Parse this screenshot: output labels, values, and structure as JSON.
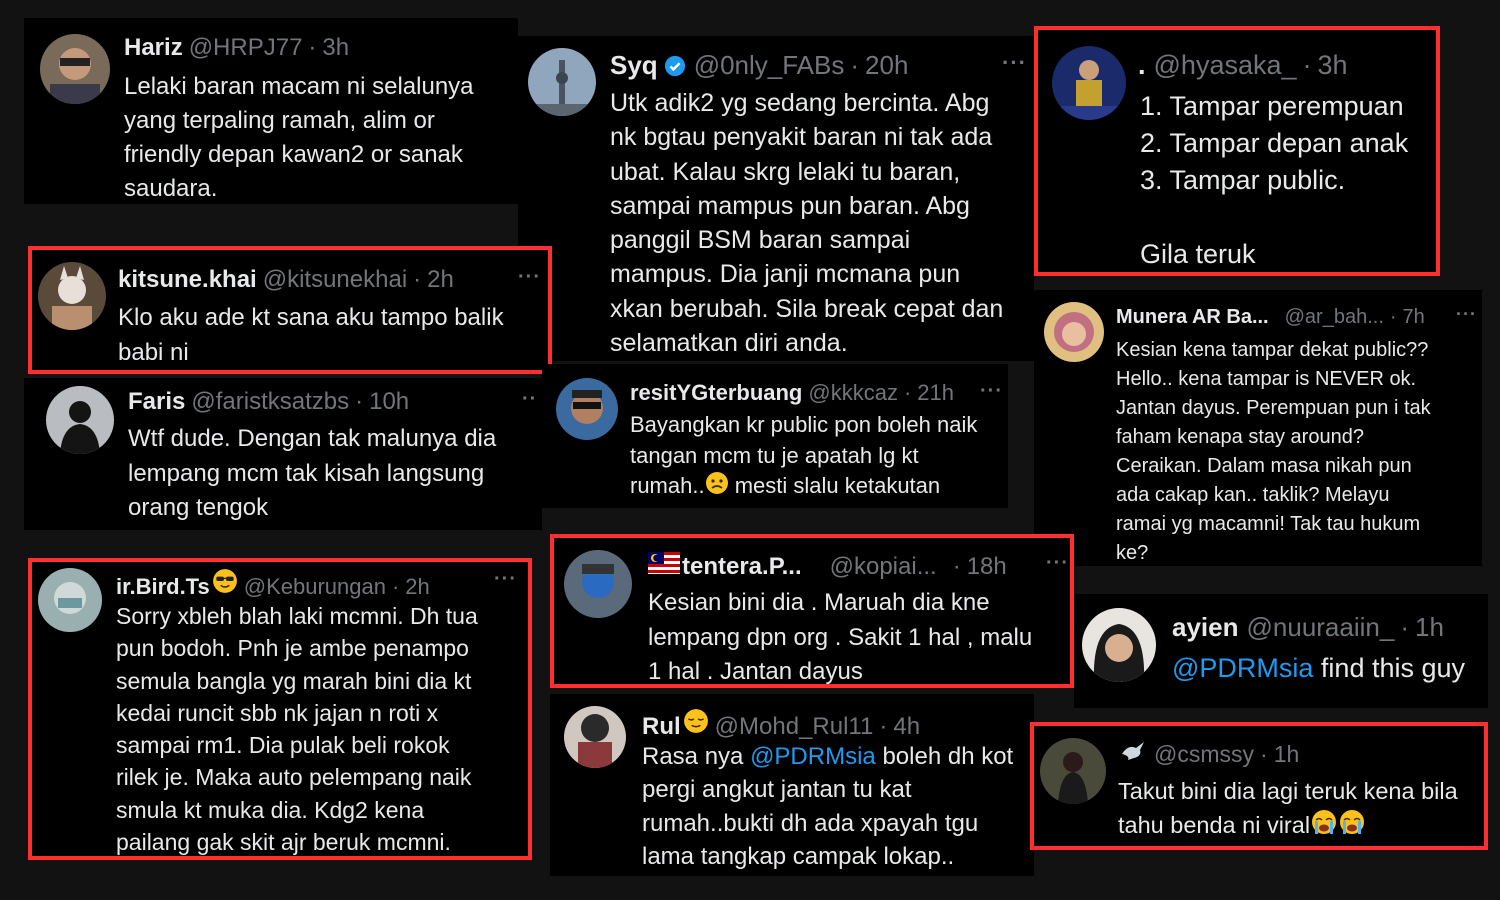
{
  "tweets": [
    {
      "name": "Hariz",
      "handle": "@HRPJ77",
      "time": "3h",
      "text": "Lelaki baran macam ni selalunya\nyang terpaling ramah, alim or\nfriendly depan kawan2 or sanak\nsaudara."
    },
    {
      "name": "Syq",
      "handle": "@0nly_FABs",
      "time": "20h",
      "text": "Utk adik2 yg sedang bercinta. Abg\nnk bgtau penyakit baran ni tak ada\nubat. Kalau skrg lelaki tu baran,\nsampai mampus pun baran. Abg\npanggil BSM baran sampai\nmampus. Dia janji mcmana pun\nxkan berubah. Sila break cepat dan\nselamatkan diri anda."
    },
    {
      "name": ".",
      "handle": "@hyasaka_",
      "time": "3h",
      "text": "1. Tampar perempuan\n2. Tampar depan anak\n3. Tampar public.\n\nGila teruk"
    },
    {
      "name": "kitsune.khai",
      "handle": "@kitsunekhai",
      "time": "2h",
      "text": "Klo aku ade kt sana aku tampo balik\nbabi ni"
    },
    {
      "name": "Faris",
      "handle": "@faristksatzbs",
      "time": "10h",
      "text": "Wtf dude. Dengan tak malunya dia\nlempang mcm tak kisah langsung\norang tengok"
    },
    {
      "name": "resitYGterbuang",
      "handle": "@kkkcaz",
      "time": "21h",
      "text1": "Bayangkan kr public pon boleh naik\ntangan mcm tu je apatah lg kt\nrumah..",
      "emoji": "sad-face",
      "text2": " mesti slalu ketakutan"
    },
    {
      "name": "Munera AR Ba...",
      "handle": "@ar_bah...",
      "time": "7h",
      "text": "Kesian kena tampar dekat public??\nHello.. kena tampar is NEVER ok.\nJantan dayus. Perempuan pun i tak\nfaham kenapa stay around?\nCeraikan. Dalam masa nikah pun\nada cakap kan.. taklik? Melayu\nramai yg macamni! Tak tau hukum\nke?"
    },
    {
      "name": "ir.Bird.Ts",
      "handle": "@Keburungan",
      "time": "2h",
      "text": "Sorry xbleh blah laki mcmni. Dh tua\npun bodoh. Pnh je ambe penampo\nsemula bangla yg marah bini dia kt\nkedai runcit sbb nk jajan n roti x\nsampai rm1. Dia pulak beli rokok\nrilek je. Maka auto pelempang naik\nsmula kt muka dia. Kdg2 kena\npailang gak skit ajr beruk mcmni."
    },
    {
      "name": "tentera.P...",
      "handle": "@kopiai...",
      "time": "18h",
      "text": "Kesian bini dia . Maruah dia kne\nlempang dpn org . Sakit 1 hal , malu\n1 hal . Jantan dayus"
    },
    {
      "name": "ayien",
      "handle": "@nuuraaiin_",
      "time": "1h",
      "mention": "@PDRMsia",
      "text": " find this guy"
    },
    {
      "name": "Rul",
      "handle": "@Mohd_Rul11",
      "time": "4h",
      "pre": "Rasa nya ",
      "mention": "@PDRMsia",
      "text": " boleh dh kot\npergi angkut jantan tu kat\nrumah..bukti dh ada xpayah tgu\nlama tangkap campak lokap.."
    },
    {
      "name": "",
      "handle": "@csmssy",
      "time": "1h",
      "text1": "Takut bini dia lagi teruk kena bila\ntahu benda ni viral",
      "emoji": "crying-faces"
    }
  ],
  "sep": "·",
  "more": "···",
  "colors": {
    "highlight": "#ff2f2f",
    "mention": "#1d9bf0",
    "verified": "#1d9bf0"
  }
}
